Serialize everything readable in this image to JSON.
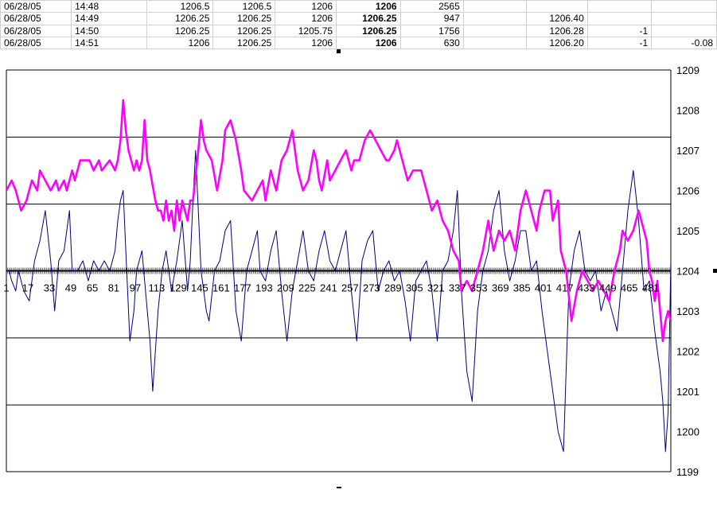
{
  "sheet": {
    "rows": [
      [
        "06/28/05",
        "14:48",
        "1206.5",
        "1206.5",
        "1206",
        "1206",
        "2565",
        "",
        "",
        "",
        ""
      ],
      [
        "06/28/05",
        "14:49",
        "1206.25",
        "1206.25",
        "1206",
        "1206.25",
        "947",
        "",
        "1206.40",
        "",
        ""
      ],
      [
        "06/28/05",
        "14:50",
        "1206.25",
        "1206.25",
        "1205.75",
        "1206.25",
        "1756",
        "",
        "1206.28",
        "-1",
        ""
      ],
      [
        "06/28/05",
        "14:51",
        "1206",
        "1206.25",
        "1206",
        "1206",
        "630",
        "",
        "1206.20",
        "-1",
        "-0.08"
      ]
    ]
  },
  "chart_data": {
    "type": "line",
    "ylim": [
      1199,
      1209
    ],
    "y_ticks": [
      "1199",
      "1200",
      "1201",
      "1202",
      "1203",
      "1204",
      "1205",
      "1206",
      "1207",
      "1208",
      "1209"
    ],
    "x_tick_labels": [
      "1",
      "17",
      "33",
      "49",
      "65",
      "81",
      "97",
      "113",
      "129",
      "145",
      "161",
      "177",
      "193",
      "209",
      "225",
      "241",
      "257",
      "273",
      "289",
      "305",
      "321",
      "337",
      "353",
      "369",
      "385",
      "401",
      "417",
      "433",
      "449",
      "465",
      "481"
    ],
    "x_range": [
      1,
      496
    ],
    "grid": "horizontal",
    "colors": {
      "price": "#ff00ff",
      "oscillator": "#000080",
      "gridline": "#000000"
    },
    "series": [
      {
        "key": "price",
        "x": [
          1,
          5,
          8,
          12,
          16,
          18,
          20,
          24,
          26,
          30,
          34,
          38,
          40,
          44,
          46,
          50,
          52,
          56,
          60,
          63,
          66,
          70,
          72,
          78,
          82,
          84,
          86,
          88,
          90,
          92,
          94,
          96,
          98,
          100,
          102,
          104,
          106,
          108,
          112,
          114,
          116,
          118,
          120,
          122,
          124,
          126,
          128,
          130,
          132,
          134,
          136,
          138,
          140,
          144,
          146,
          148,
          150,
          154,
          158,
          162,
          164,
          168,
          172,
          176,
          178,
          184,
          188,
          192,
          194,
          198,
          202,
          206,
          210,
          214,
          218,
          222,
          226,
          230,
          232,
          234,
          236,
          240,
          242,
          246,
          250,
          254,
          258,
          260,
          264,
          268,
          272,
          276,
          280,
          284,
          286,
          290,
          292,
          296,
          300,
          304,
          306,
          310,
          314,
          318,
          322,
          326,
          330,
          334,
          338,
          340,
          344,
          348,
          350,
          352,
          356,
          360,
          364,
          368,
          372,
          376,
          380,
          384,
          388,
          392,
          396,
          398,
          402,
          406,
          408,
          412,
          414,
          418,
          422,
          426,
          430,
          434,
          438,
          442,
          446,
          450,
          454,
          458,
          460,
          464,
          468,
          472,
          476,
          478,
          480,
          482,
          484,
          486,
          488,
          490,
          492,
          494,
          496
        ],
        "y": [
          1206.0,
          1206.25,
          1206.0,
          1205.5,
          1205.75,
          1206.0,
          1206.25,
          1206.0,
          1206.5,
          1206.25,
          1206.0,
          1206.25,
          1206.0,
          1206.25,
          1206.0,
          1206.5,
          1206.25,
          1206.75,
          1206.75,
          1206.75,
          1206.5,
          1206.75,
          1206.5,
          1206.75,
          1206.5,
          1206.75,
          1207.25,
          1208.25,
          1207.5,
          1207.0,
          1206.75,
          1206.5,
          1206.75,
          1206.5,
          1206.75,
          1207.75,
          1206.75,
          1206.5,
          1205.75,
          1205.5,
          1205.5,
          1205.25,
          1205.75,
          1205.25,
          1205.5,
          1205.0,
          1205.75,
          1205.25,
          1205.75,
          1205.5,
          1205.25,
          1205.75,
          1205.75,
          1207.0,
          1207.75,
          1207.25,
          1207.0,
          1206.75,
          1206.0,
          1206.75,
          1207.5,
          1207.75,
          1207.25,
          1206.5,
          1206.0,
          1205.75,
          1206.0,
          1206.25,
          1205.75,
          1206.5,
          1206.0,
          1206.75,
          1207.0,
          1207.5,
          1206.5,
          1206.0,
          1206.25,
          1207.0,
          1206.75,
          1206.25,
          1206.0,
          1206.75,
          1206.25,
          1206.5,
          1206.75,
          1207.0,
          1206.5,
          1206.75,
          1206.75,
          1207.25,
          1207.5,
          1207.25,
          1207.0,
          1206.75,
          1206.75,
          1207.0,
          1207.25,
          1206.75,
          1206.25,
          1206.5,
          1206.5,
          1206.5,
          1206.0,
          1205.5,
          1205.75,
          1205.25,
          1205.0,
          1204.5,
          1204.25,
          1203.5,
          1203.75,
          1203.5,
          1203.75,
          1204.0,
          1204.5,
          1205.25,
          1204.5,
          1205.0,
          1204.75,
          1205.0,
          1204.5,
          1205.5,
          1206.0,
          1205.5,
          1205.0,
          1205.5,
          1206.0,
          1206.0,
          1205.25,
          1205.75,
          1204.5,
          1204.0,
          1202.75,
          1203.5,
          1204.0,
          1203.75,
          1203.5,
          1203.75,
          1203.5,
          1203.25,
          1204.0,
          1204.5,
          1205.0,
          1204.75,
          1205.0,
          1205.5,
          1205.0,
          1204.75,
          1204.0,
          1203.75,
          1203.25,
          1203.75,
          1203.0,
          1202.25,
          1202.75,
          1203.0,
          1202.75
        ]
      },
      {
        "key": "oscillator",
        "x": [
          1,
          3,
          5,
          8,
          10,
          14,
          18,
          22,
          26,
          30,
          34,
          37,
          40,
          44,
          48,
          50,
          54,
          58,
          62,
          66,
          70,
          74,
          78,
          80,
          82,
          84,
          86,
          88,
          90,
          93,
          96,
          98,
          100,
          102,
          106,
          108,
          110,
          114,
          117,
          120,
          124,
          128,
          132,
          136,
          138,
          140,
          142,
          144,
          146,
          148,
          150,
          152,
          156,
          160,
          164,
          168,
          172,
          176,
          180,
          184,
          188,
          190,
          194,
          198,
          202,
          206,
          210,
          214,
          218,
          222,
          226,
          230,
          234,
          238,
          242,
          246,
          250,
          254,
          258,
          262,
          266,
          270,
          274,
          278,
          282,
          286,
          290,
          294,
          298,
          302,
          306,
          310,
          314,
          318,
          322,
          326,
          330,
          334,
          337,
          340,
          344,
          348,
          352,
          356,
          360,
          364,
          368,
          372,
          376,
          380,
          384,
          388,
          392,
          396,
          400,
          404,
          408,
          412,
          416,
          418,
          420,
          424,
          428,
          432,
          436,
          440,
          444,
          448,
          452,
          456,
          460,
          464,
          468,
          472,
          476,
          480,
          484,
          488,
          490,
          492,
          494,
          496
        ],
        "y": [
          1204.0,
          1204.0,
          1203.75,
          1203.5,
          1204.0,
          1203.5,
          1203.25,
          1204.25,
          1204.75,
          1205.5,
          1204.25,
          1203.0,
          1204.25,
          1204.5,
          1205.5,
          1204.0,
          1204.0,
          1204.25,
          1203.75,
          1204.25,
          1204.0,
          1204.25,
          1204.0,
          1204.25,
          1204.5,
          1205.25,
          1205.75,
          1206.0,
          1204.5,
          1202.25,
          1203.0,
          1204.0,
          1204.25,
          1204.5,
          1203.0,
          1202.25,
          1201.0,
          1203.0,
          1204.0,
          1204.5,
          1203.5,
          1204.25,
          1205.25,
          1203.5,
          1204.25,
          1205.75,
          1207.0,
          1205.5,
          1204.0,
          1203.5,
          1203.0,
          1202.75,
          1204.0,
          1204.25,
          1205.0,
          1205.25,
          1203.0,
          1202.25,
          1204.0,
          1204.5,
          1205.0,
          1204.0,
          1203.75,
          1204.5,
          1205.0,
          1203.5,
          1202.25,
          1203.5,
          1204.25,
          1205.0,
          1204.0,
          1203.75,
          1204.5,
          1205.0,
          1204.25,
          1204.0,
          1204.5,
          1205.0,
          1203.5,
          1202.25,
          1204.25,
          1204.75,
          1205.0,
          1203.5,
          1204.0,
          1204.25,
          1203.75,
          1204.0,
          1203.25,
          1202.25,
          1203.75,
          1204.0,
          1204.25,
          1203.5,
          1202.25,
          1204.0,
          1204.25,
          1205.0,
          1206.0,
          1203.5,
          1201.5,
          1200.75,
          1203.0,
          1204.0,
          1204.5,
          1205.5,
          1206.0,
          1204.5,
          1203.75,
          1204.25,
          1205.0,
          1205.0,
          1204.0,
          1204.25,
          1203.0,
          1202.0,
          1201.0,
          1200.0,
          1199.5,
          1201.5,
          1203.5,
          1204.5,
          1205.0,
          1204.0,
          1203.75,
          1204.0,
          1203.0,
          1203.5,
          1203.0,
          1202.5,
          1204.0,
          1205.5,
          1206.5,
          1205.25,
          1203.5,
          1203.75,
          1202.5,
          1201.5,
          1200.75,
          1199.5,
          1200.5,
          1204.25
        ]
      }
    ]
  }
}
